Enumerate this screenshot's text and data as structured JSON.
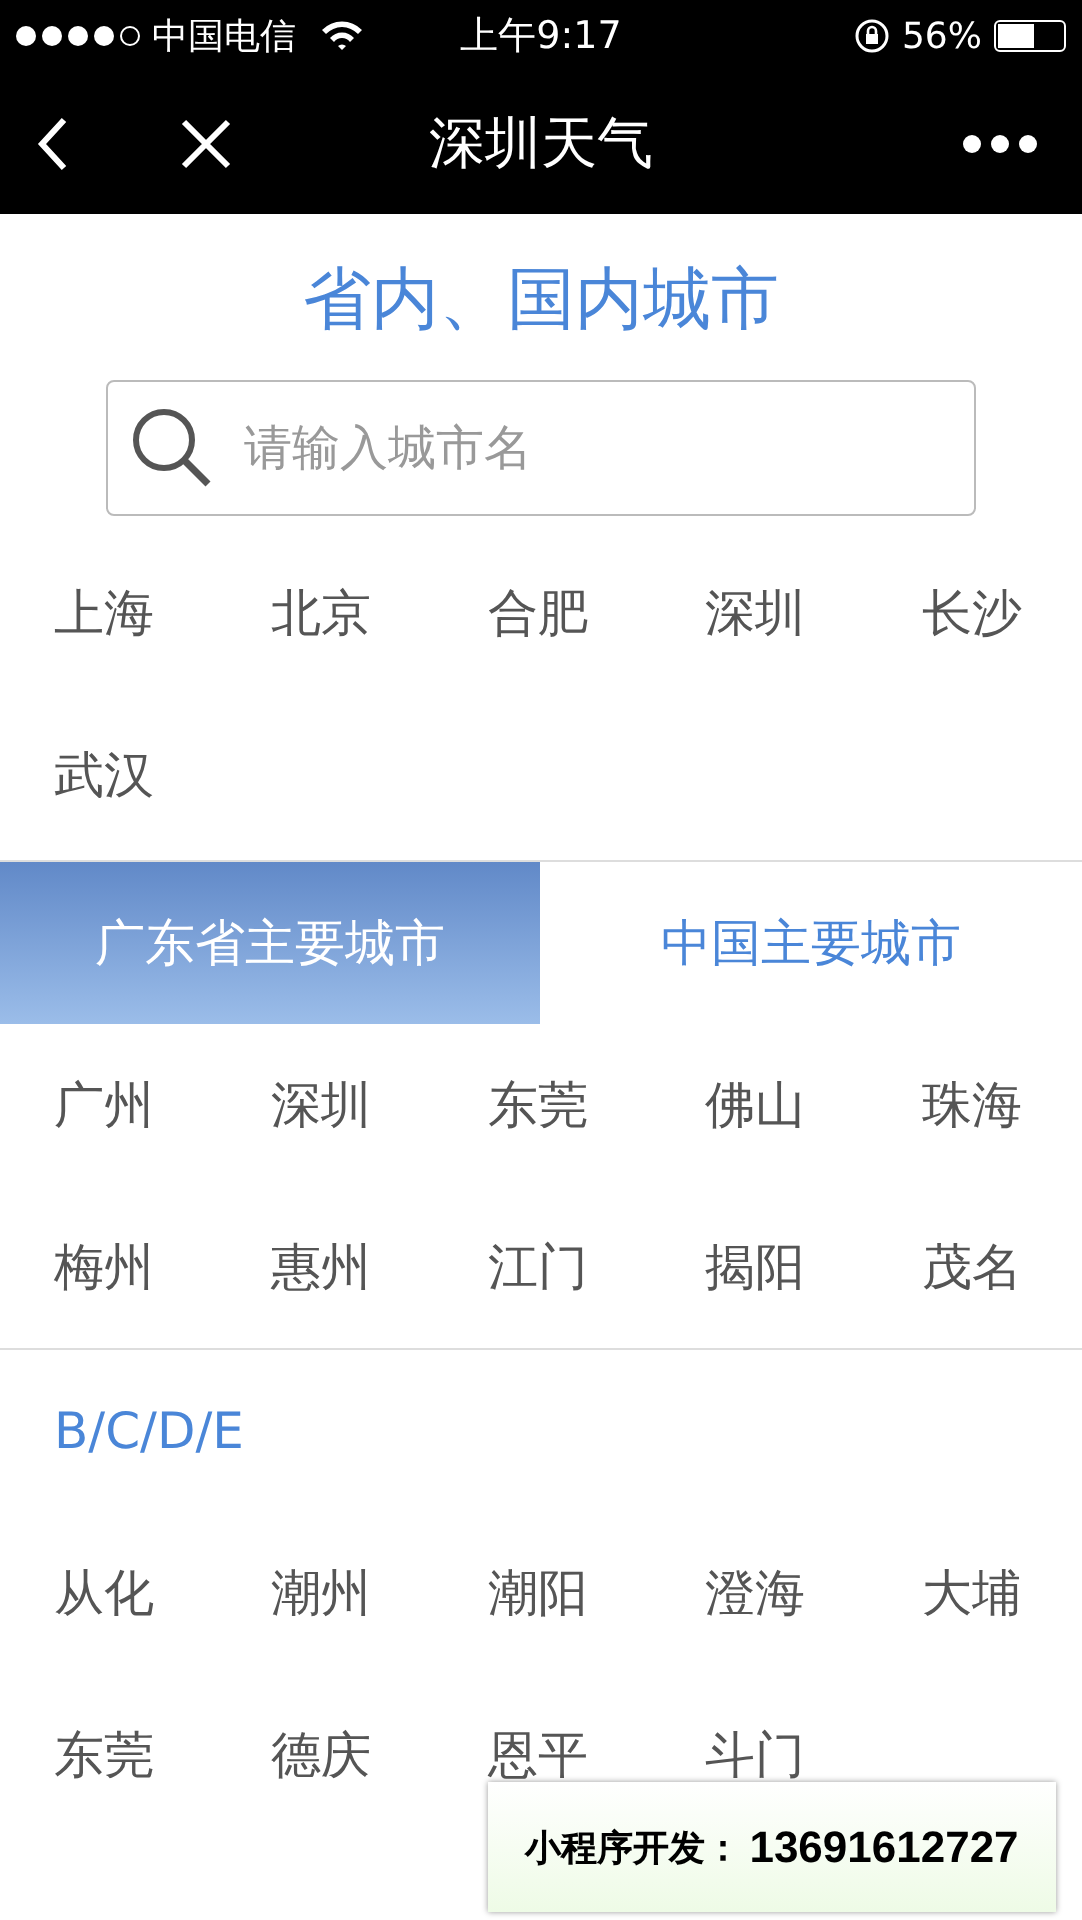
{
  "status_bar": {
    "carrier": "中国电信",
    "time": "上午9:17",
    "battery": "56%"
  },
  "nav": {
    "title": "深圳天气"
  },
  "heading": "省内、国内城市",
  "search": {
    "placeholder": "请输入城市名"
  },
  "hot_cities": [
    "上海",
    "北京",
    "合肥",
    "深圳",
    "长沙",
    "武汉"
  ],
  "tabs": [
    {
      "label": "广东省主要城市",
      "selected": true
    },
    {
      "label": "中国主要城市",
      "selected": false
    }
  ],
  "tab_cities": [
    "广州",
    "深圳",
    "东莞",
    "佛山",
    "珠海",
    "梅州",
    "惠州",
    "江门",
    "揭阳",
    "茂名"
  ],
  "sections": [
    {
      "letters": "B/C/D/E",
      "cities": [
        "从化",
        "潮州",
        "潮阳",
        "澄海",
        "大埔",
        "东莞",
        "德庆",
        "恩平",
        "斗门"
      ]
    }
  ],
  "banner": {
    "label": "小程序开发：",
    "phone": "13691612727"
  }
}
